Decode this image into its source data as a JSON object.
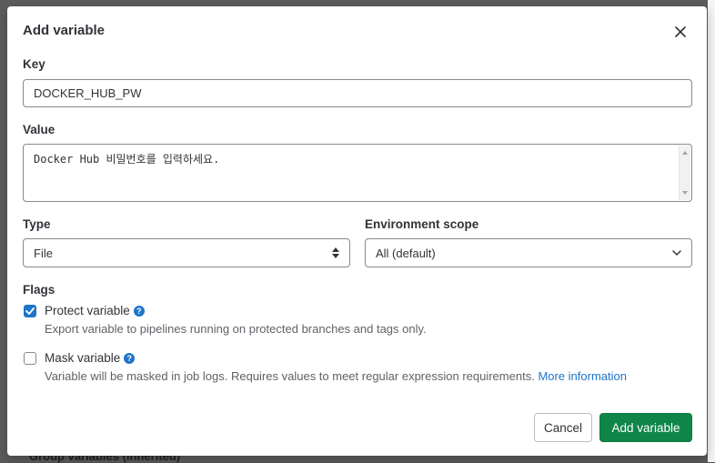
{
  "modal": {
    "title": "Add variable",
    "close_icon": "close-icon"
  },
  "key": {
    "label": "Key",
    "value": "DOCKER_HUB_PW"
  },
  "value": {
    "label": "Value",
    "value": "Docker Hub 비밀번호를 입력하세요."
  },
  "type": {
    "label": "Type",
    "selected": "File"
  },
  "environment_scope": {
    "label": "Environment scope",
    "selected": "All (default)"
  },
  "flags": {
    "label": "Flags",
    "protect": {
      "label": "Protect variable",
      "checked": true,
      "help": "Export variable to pipelines running on protected branches and tags only."
    },
    "mask": {
      "label": "Mask variable",
      "checked": false,
      "help": "Variable will be masked in job logs. Requires values to meet regular expression requirements.",
      "link": "More information"
    }
  },
  "footer": {
    "cancel_label": "Cancel",
    "submit_label": "Add variable"
  },
  "background": {
    "partial_text": "Group variables (inherited)"
  },
  "colors": {
    "primary_button": "#108548",
    "checkbox_checked": "#1f75cb",
    "link": "#1f75cb"
  }
}
